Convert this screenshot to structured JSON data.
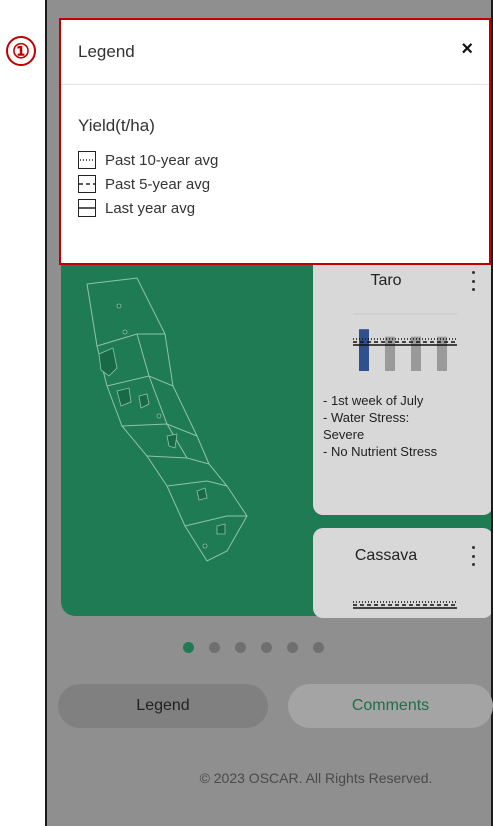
{
  "annotation": {
    "step_marker": "①"
  },
  "legend_modal": {
    "title": "Legend",
    "close_symbol": "×",
    "heading": "Yield(t/ha)",
    "items": [
      {
        "label": "Past 10-year avg",
        "line_style": "dotted"
      },
      {
        "label": "Past 5-year avg",
        "line_style": "dashed"
      },
      {
        "label": "Last year avg",
        "line_style": "solid"
      }
    ]
  },
  "crop_cards": [
    {
      "name": "Taro",
      "info": [
        "- 1st week of July",
        "- Water Stress:",
        "Severe",
        "- No Nutrient Stress"
      ],
      "bar_values": [
        0.95,
        0.78,
        0.78,
        0.78
      ],
      "bar_colors": [
        "#2f4f8f",
        "#9a9a9a",
        "#9a9a9a",
        "#9a9a9a"
      ]
    },
    {
      "name": "Cassava"
    }
  ],
  "carousel": {
    "total": 6,
    "active_index": 0
  },
  "buttons": {
    "legend": "Legend",
    "comments": "Comments"
  },
  "footer": {
    "copyright": "© 2023 OSCAR. All Rights Reserved."
  },
  "colors": {
    "brand_green": "#1e7b53",
    "highlight_red": "#c00000",
    "overlay_gray": "#8f8f8f"
  }
}
